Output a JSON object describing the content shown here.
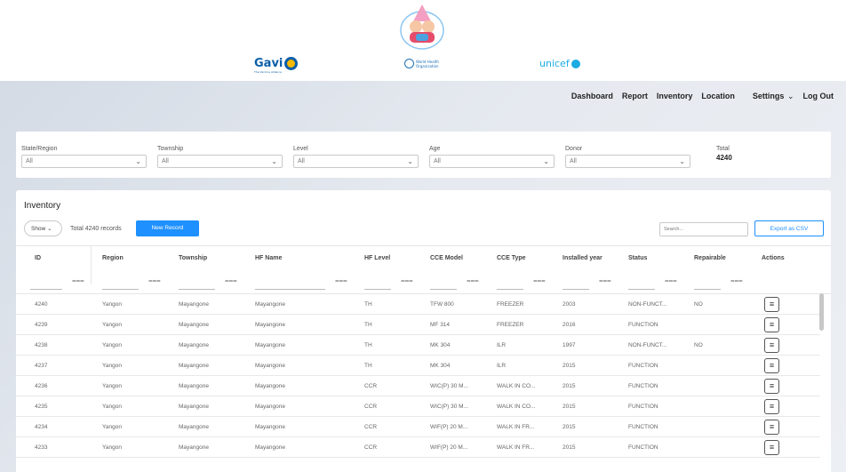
{
  "header": {
    "logos": {
      "gavi": "Gavi",
      "gavi_sub": "The Vaccine Alliance",
      "who": "World Health Organization",
      "unicef": "unicef"
    }
  },
  "nav": {
    "items": [
      "Dashboard",
      "Report",
      "Inventory",
      "Location",
      "Settings",
      "Log Out"
    ],
    "settings_chevron": "v"
  },
  "filters": [
    {
      "label": "State/Region",
      "value": "All"
    },
    {
      "label": "Township",
      "value": "All"
    },
    {
      "label": "Level",
      "value": "All"
    },
    {
      "label": "Age",
      "value": "All"
    },
    {
      "label": "Donor",
      "value": "All"
    }
  ],
  "total": {
    "label": "Total",
    "value": "4240"
  },
  "inventory": {
    "title": "Inventory",
    "show_label": "Show",
    "total_records": "Total 4240 records",
    "new_record": "New Record",
    "search_placeholder": "Search...",
    "export_csv": "Export as CSV",
    "columns": [
      "ID",
      "Region",
      "Township",
      "HF Name",
      "HF Level",
      "CCE Model",
      "CCE Type",
      "Installed year",
      "Status",
      "Repairable",
      "Actions"
    ],
    "rows": [
      [
        "4240",
        "Yangon",
        "Mayangone",
        "Mayangone",
        "TH",
        "TFW 800",
        "FREEZER",
        "2003",
        "NON-FUNCT...",
        "NO"
      ],
      [
        "4239",
        "Yangon",
        "Mayangone",
        "Mayangone",
        "TH",
        "MF 314",
        "FREEZER",
        "2016",
        "FUNCTION",
        ""
      ],
      [
        "4238",
        "Yangon",
        "Mayangone",
        "Mayangone",
        "TH",
        "MK 304",
        "ILR",
        "1997",
        "NON-FUNCT...",
        "NO"
      ],
      [
        "4237",
        "Yangon",
        "Mayangone",
        "Mayangone",
        "TH",
        "MK 304",
        "ILR",
        "2015",
        "FUNCTION",
        ""
      ],
      [
        "4236",
        "Yangon",
        "Mayangone",
        "Mayangone",
        "CCR",
        "WIC(P) 30 M...",
        "WALK IN CO...",
        "2015",
        "FUNCTION",
        ""
      ],
      [
        "4235",
        "Yangon",
        "Mayangone",
        "Mayangone",
        "CCR",
        "WIC(P) 30 M...",
        "WALK IN CO...",
        "2015",
        "FUNCTION",
        ""
      ],
      [
        "4234",
        "Yangon",
        "Mayangone",
        "Mayangone",
        "CCR",
        "WIF(P) 20 M...",
        "WALK IN FR...",
        "2015",
        "FUNCTION",
        ""
      ],
      [
        "4233",
        "Yangon",
        "Mayangone",
        "Mayangone",
        "CCR",
        "WIF(P) 20 M...",
        "WALK IN FR...",
        "2015",
        "FUNCTION",
        ""
      ]
    ],
    "action_icon": "menu-icon"
  },
  "colors": {
    "accent": "#1e90ff",
    "gavi": "#0a5fa8",
    "unicef": "#1cabe2"
  }
}
